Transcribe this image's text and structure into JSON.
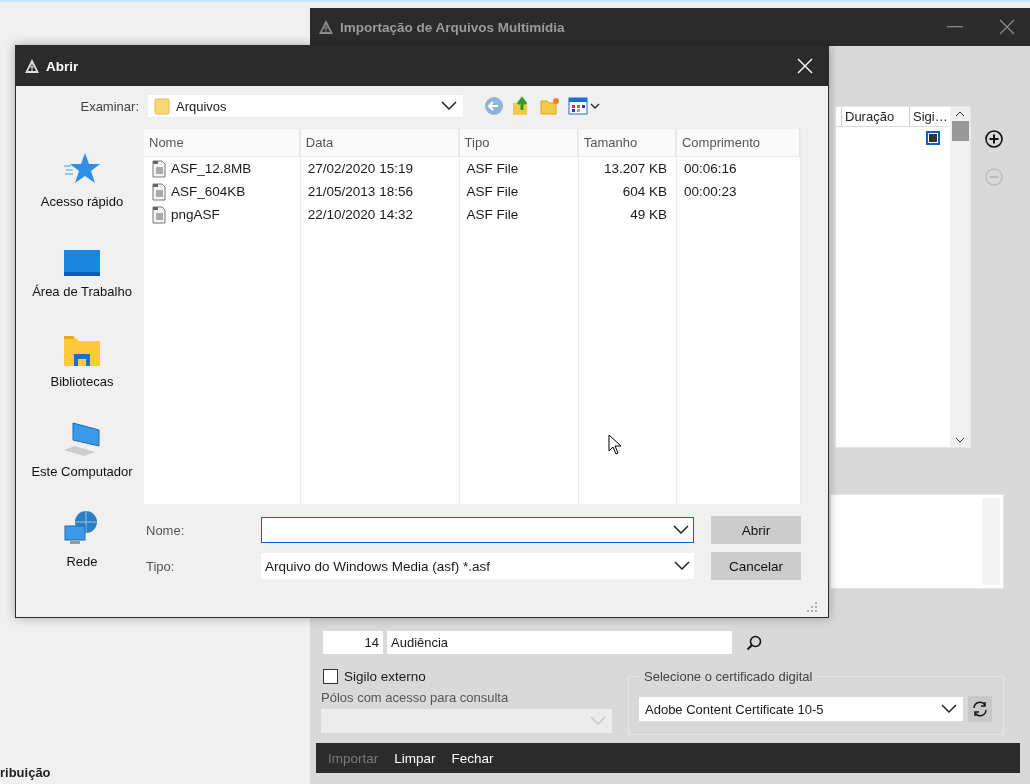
{
  "background_app": {
    "label": "ribuição"
  },
  "import_window": {
    "title": "Importação de Arquivos Multimídia",
    "table": {
      "columns": [
        "Duração",
        "Sigi…"
      ],
      "rows": [
        {
          "secret": true
        }
      ]
    },
    "category": {
      "code": "14",
      "name": "Audiência"
    },
    "external_secrecy": {
      "label": "Sigilo externo",
      "checked": false
    },
    "poles": {
      "label": "Pólos com acesso para consulta",
      "disabled": true
    },
    "certificate": {
      "legend": "Selecione o certificado digital",
      "value": "Adobe Content Certificate 10-5"
    },
    "actions": [
      {
        "label": "Importar",
        "disabled": true
      },
      {
        "label": "Limpar",
        "disabled": false
      },
      {
        "label": "Fechar",
        "disabled": false
      }
    ]
  },
  "open_dialog": {
    "title": "Abrir",
    "look_in": {
      "label": "Examinar:",
      "value": "Arquivos"
    },
    "places": [
      {
        "label": "Acesso rápido",
        "kind": "quick"
      },
      {
        "label": "Área de Trabalho",
        "kind": "desktop"
      },
      {
        "label": "Bibliotecas",
        "kind": "libraries"
      },
      {
        "label": "Este Computador",
        "kind": "computer"
      },
      {
        "label": "Rede",
        "kind": "network"
      }
    ],
    "columns": [
      "Nome",
      "Data",
      "Tipo",
      "Tamanho",
      "Comprimento"
    ],
    "files": [
      {
        "name": "ASF_12.8MB",
        "date": "27/02/2020 15:19",
        "type": "ASF File",
        "size": "13.207 KB",
        "length": "00:06:16"
      },
      {
        "name": "ASF_604KB",
        "date": "21/05/2013 18:56",
        "type": "ASF File",
        "size": "604 KB",
        "length": "00:00:23"
      },
      {
        "name": "pngASF",
        "date": "22/10/2020 14:32",
        "type": "ASF File",
        "size": "49 KB"
      }
    ],
    "file_name": {
      "label": "Nome:"
    },
    "file_type": {
      "label": "Tipo:",
      "value": "Arquivo do Windows Media (asf) *.asf"
    },
    "buttons": [
      "Abrir",
      "Cancelar"
    ]
  }
}
